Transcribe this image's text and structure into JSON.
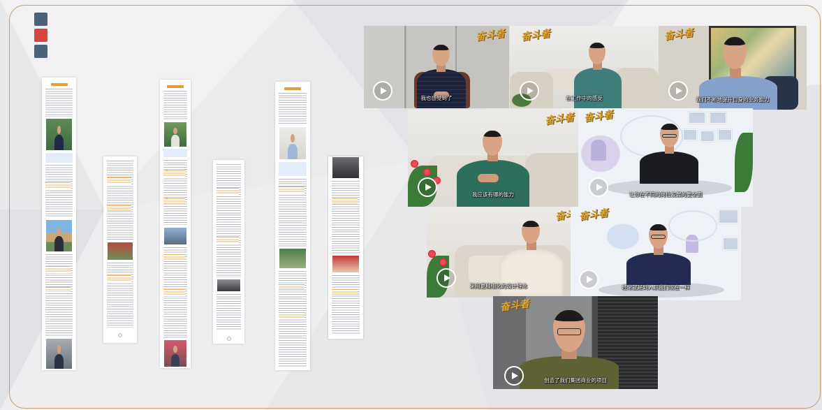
{
  "slide": {
    "border_color": "#c99a66",
    "accent_squares": [
      "#4a6279",
      "#d8453f",
      "#4a6279"
    ]
  },
  "videos": {
    "logo": "奋斗者",
    "logo_color": "#dba83c",
    "play_icon": "play-icon",
    "items": [
      {
        "subtitle": "我也感觉到了"
      },
      {
        "subtitle": "在工作中的感受"
      },
      {
        "subtitle": "我们不断地提升自身的业务能力"
      },
      {
        "subtitle": "我应该有哪的能力"
      },
      {
        "subtitle": "让你在不同的岗位发展的更全面"
      },
      {
        "subtitle": "采用更精细化的设计理念"
      },
      {
        "subtitle": "经常就是到入职我们现在一样"
      },
      {
        "subtitle": "创造了我们集团商业的项目"
      }
    ]
  }
}
